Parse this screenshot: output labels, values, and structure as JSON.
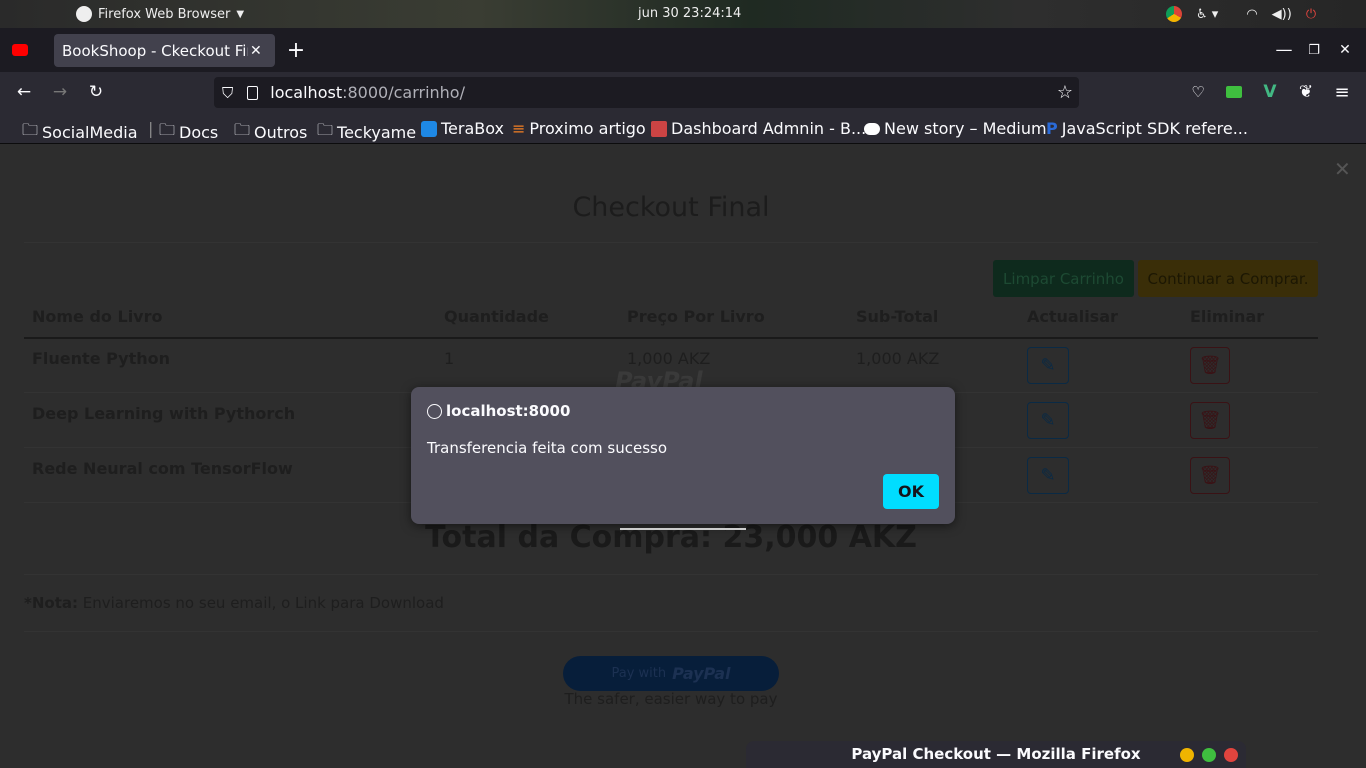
{
  "os": {
    "app_name": "Firefox Web Browser",
    "datetime": "jun 30  23:24:14"
  },
  "browser": {
    "tab_title": "BookShoop - Ckeckout Final",
    "url_host": "localhost",
    "url_rest": ":8000/carrinho/",
    "bookmarks": [
      "SocialMedia",
      "Docs",
      "Outros",
      "Teckyame",
      "TeraBox",
      "Proximo artigo",
      "Dashboard Admnin - B...",
      "New story – Medium",
      "JavaScript SDK refere..."
    ]
  },
  "page": {
    "title": "Checkout Final",
    "clear_cart_label": "Limpar Carrinho",
    "continue_label": "Continuar a Comprar.",
    "columns": [
      "Nome do Livro",
      "Quantidade",
      "Preço Por Livro",
      "Sub-Total",
      "Actualisar",
      "Eliminar"
    ],
    "rows": [
      {
        "name": "Fluente Python",
        "qty": "1",
        "price": "1,000 AKZ",
        "subtotal": "1,000 AKZ"
      },
      {
        "name": "Deep Learning with Pythorch",
        "qty": "",
        "price": "",
        "subtotal": ""
      },
      {
        "name": "Rede Neural com TensorFlow",
        "qty": "",
        "price": "",
        "subtotal": ""
      }
    ],
    "total": "Total da Compra: 23,000 AKZ",
    "note_label": "*Nota:",
    "note_text": " Enviaremos no seu email, o Link para Download",
    "paypal_pay_with": "Pay with",
    "paypal_brand": "PayPal",
    "paypal_tagline": "The safer, easier way to pay",
    "paypal_overlay_logo": "PayPal"
  },
  "dialog": {
    "origin": "localhost:8000",
    "message": "Transferencia feita com sucesso",
    "ok_label": "OK"
  },
  "popup_window": {
    "title": "PayPal Checkout — Mozilla Firefox",
    "colors": [
      "#f0b400",
      "#3fbf3f",
      "#e0443e"
    ]
  }
}
